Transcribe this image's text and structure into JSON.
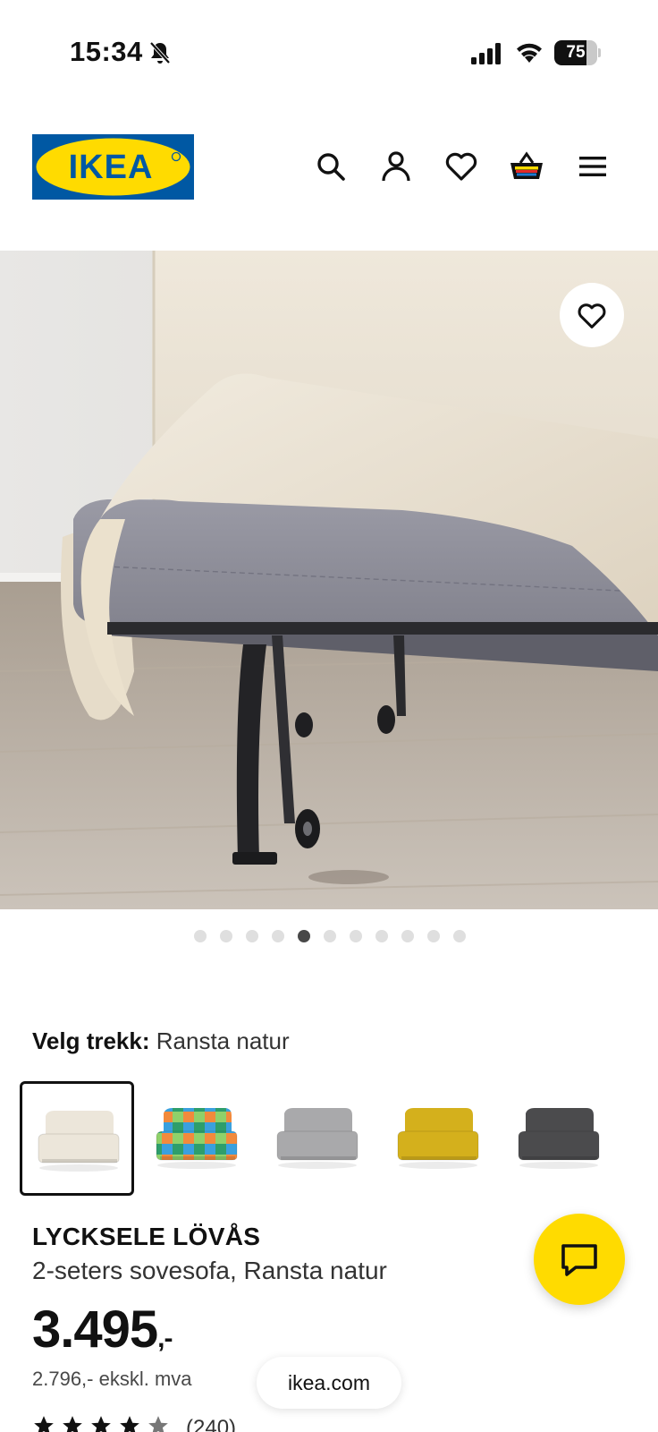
{
  "status_bar": {
    "time": "15:34",
    "battery_level": "75",
    "icons": [
      "bell-muted-icon",
      "signal-icon",
      "wifi-icon",
      "battery-icon"
    ]
  },
  "header": {
    "logo_text": "IKEA",
    "icons": [
      "search-icon",
      "profile-icon",
      "heart-icon",
      "cart-icon",
      "menu-icon"
    ]
  },
  "hero": {
    "total_images": 11,
    "active_index": 4,
    "favorite_icon": "heart-icon"
  },
  "cover": {
    "label": "Velg trekk:",
    "value": "Ransta natur",
    "swatch_colors": [
      "#ece6da",
      "multicolor",
      "#a9a9ab",
      "#d4b01c",
      "#4b4b4d"
    ],
    "selected_index": 0
  },
  "product": {
    "name": "LYCKSELE LÖVÅS",
    "description": "2-seters sovesofa, Ransta natur",
    "price": "3.495",
    "price_suffix": ",-",
    "price_ex_vat": "2.796,- ekskl. mva",
    "rating_count": "(240)",
    "rating": 4.5
  },
  "footer": {
    "url": "ikea.com",
    "chat_icon": "chat-icon"
  },
  "colors": {
    "ikea_blue": "#0058a3",
    "ikea_yellow": "#ffdb00"
  }
}
